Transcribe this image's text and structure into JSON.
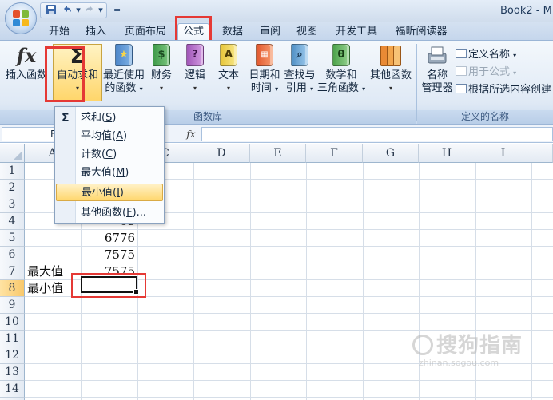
{
  "window": {
    "title": "Book2 - M"
  },
  "quick_access": {
    "save_icon": "save-icon",
    "undo_icon": "undo-icon",
    "redo_icon": "redo-icon",
    "customize": "="
  },
  "tabs": [
    {
      "label": "开始"
    },
    {
      "label": "插入"
    },
    {
      "label": "页面布局"
    },
    {
      "label": "公式"
    },
    {
      "label": "数据"
    },
    {
      "label": "审阅"
    },
    {
      "label": "视图"
    },
    {
      "label": "开发工具"
    },
    {
      "label": "福昕阅读器"
    }
  ],
  "ribbon": {
    "function_library": {
      "group_label": "函数库",
      "insert_function": "插入函数",
      "autosum": "自动求和",
      "recent_line1": "最近使用",
      "recent_line2": "的函数",
      "financial": "财务",
      "logical": "逻辑",
      "text": "文本",
      "datetime_line1": "日期和",
      "datetime_line2": "时间",
      "lookup_line1": "查找与",
      "lookup_line2": "引用",
      "math_line1": "数学和",
      "math_line2": "三角函数",
      "more": "其他函数"
    },
    "defined_names": {
      "group_label": "定义的名称",
      "name_manager_line1": "名称",
      "name_manager_line2": "管理器",
      "define_name": "定义名称",
      "use_in_formula": "用于公式",
      "create_from_selection": "根据所选内容创建"
    }
  },
  "formula_bar": {
    "name_box": "B",
    "fx": "fx",
    "value": ""
  },
  "autosum_menu": {
    "items": [
      {
        "label": "求和(",
        "key": "S",
        "suffix": ")"
      },
      {
        "label": "平均值(",
        "key": "A",
        "suffix": ")"
      },
      {
        "label": "计数(",
        "key": "C",
        "suffix": ")"
      },
      {
        "label": "最大值(",
        "key": "M",
        "suffix": ")"
      },
      {
        "label": "最小值(",
        "key": "I",
        "suffix": ")"
      },
      {
        "label": "其他函数(",
        "key": "F",
        "suffix": ")..."
      }
    ],
    "sigma": "Σ"
  },
  "sheet": {
    "columns": [
      "A",
      "B",
      "C",
      "D",
      "E",
      "F",
      "G",
      "H",
      "I"
    ],
    "rows": [
      "1",
      "2",
      "3",
      "4",
      "5",
      "6",
      "7",
      "8",
      "9",
      "10",
      "11",
      "12",
      "13",
      "14",
      "15"
    ],
    "cells": {
      "B4": "65",
      "B5": "6776",
      "B6": "7575",
      "B7": "7575",
      "A7": "最大值",
      "A8": "最小值"
    }
  },
  "watermark": {
    "text": "搜狗指南",
    "sub": "zhinan.sogou.com"
  },
  "colors": {
    "highlight": "#e53935",
    "ribbon_blue": "#dfe9f5",
    "menu_hover": "#ffd76e"
  }
}
